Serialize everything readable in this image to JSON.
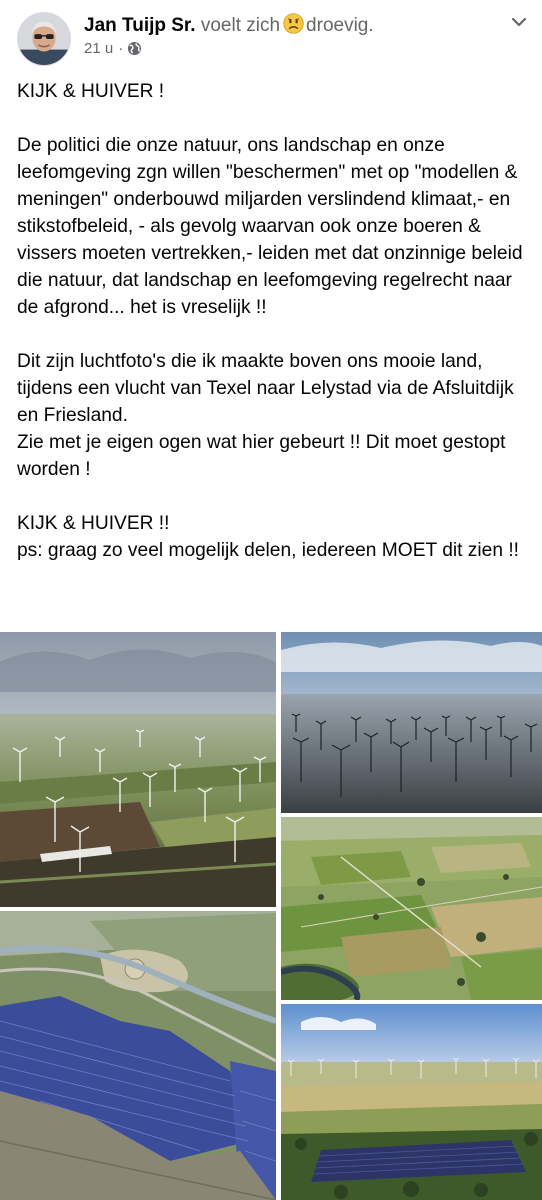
{
  "post": {
    "author": "Jan Tuijp Sr.",
    "feeling_verb": "voelt zich",
    "feeling_emoji": "sad-face-icon",
    "feeling_word": "droevig.",
    "timestamp": "21 u",
    "separator": "·",
    "privacy_icon": "globe-icon",
    "menu_icon": "chevron-down-icon"
  },
  "body": {
    "line_1": "KIJK & HUIVER !",
    "paragraph_1": "De politici die onze natuur, ons landschap en onze leefomgeving zgn willen \"beschermen\" met op \"modellen & meningen\" onderbouwd miljarden verslindend klimaat,- en stikstofbeleid, - als gevolg waarvan ook onze boeren & vissers moeten vertrekken,- leiden met dat onzinnige beleid die natuur, dat landschap en leefomgeving regelrecht naar de afgrond... het is vreselijk !!",
    "paragraph_2a": "Dit zijn luchtfoto's die ik maakte boven ons mooie land, tijdens een vlucht van Texel naar Lelystad via de Afsluitdijk en Friesland.",
    "paragraph_2b": "Zie met je eigen ogen wat hier gebeurt !! Dit moet gestopt worden !",
    "line_2": "KIJK & HUIVER !!",
    "line_3": "ps: graag zo veel mogelijk delen, iedereen MOET dit zien !!"
  },
  "photos": [
    {
      "subject": "wind-turbines-farmland"
    },
    {
      "subject": "offshore-wind-farm"
    },
    {
      "subject": "green-farmland-river"
    },
    {
      "subject": "solar-park"
    },
    {
      "subject": "solar-park-wind-farm"
    }
  ],
  "colors": {
    "name_text": "#050505",
    "meta_text": "#65676b",
    "emoji_yellow": "#f7b125"
  }
}
